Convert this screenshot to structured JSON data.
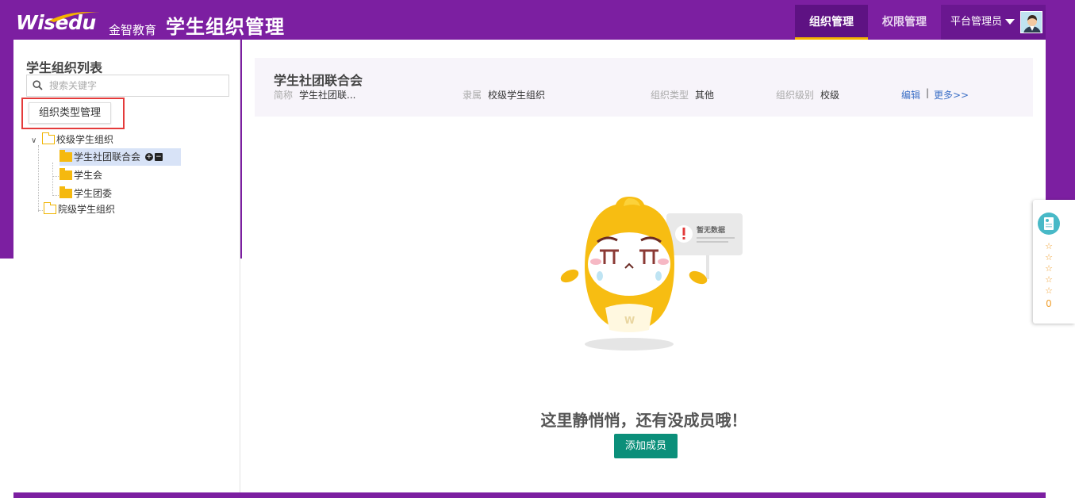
{
  "colors": {
    "brand_purple": "#7c1fa1",
    "active_tab_underline": "#f5b400",
    "primary_button": "#0b8f7a",
    "link": "#3b6fc6",
    "highlight_frame": "#e43b3b"
  },
  "header": {
    "logo_text": "Wisedu",
    "logo_cn": "金智教育",
    "app_title": "学生组织管理",
    "tabs": [
      {
        "label": "组织管理",
        "active": true
      },
      {
        "label": "权限管理",
        "active": false
      }
    ],
    "user": {
      "name": "平台管理员",
      "avatar_icon": "user-avatar-icon",
      "dropdown_icon": "caret-down-icon"
    }
  },
  "sidebar": {
    "title": "学生组织列表",
    "search": {
      "placeholder": "搜索关键字",
      "value": "",
      "icon": "search-icon"
    },
    "type_manage_button": "组织类型管理",
    "tree": [
      {
        "label": "校级学生组织",
        "expanded": true,
        "children": [
          {
            "label": "学生社团联合会",
            "selected": true
          },
          {
            "label": "学生会"
          },
          {
            "label": "学生团委"
          }
        ]
      },
      {
        "label": "院级学生组织",
        "expanded": false
      }
    ]
  },
  "main": {
    "org": {
      "name": "学生社团联合会",
      "fields": [
        {
          "label": "简称",
          "value": "学生社团联..."
        },
        {
          "label": "隶属",
          "value": "校级学生组织"
        },
        {
          "label": "组织类型",
          "value": "其他"
        },
        {
          "label": "组织级别",
          "value": "校级"
        }
      ],
      "edit_link": "编辑",
      "separator": "|",
      "more_link": "更多>>"
    },
    "empty_state": {
      "sign_text": "暂无数据",
      "message": "这里静悄悄，还有没成员哦！",
      "add_button": "添加成员"
    }
  },
  "float_widget": {
    "stars": [
      "☆",
      "☆",
      "☆",
      "☆",
      "☆"
    ],
    "count": "0"
  }
}
